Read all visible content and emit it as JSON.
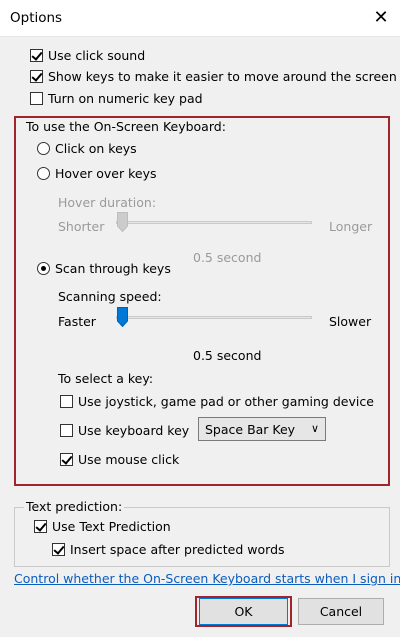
{
  "window": {
    "title": "Options",
    "close_glyph": "✕"
  },
  "top_options": [
    {
      "label": "Use click sound",
      "checked": true
    },
    {
      "label": "Show keys to make it easier to move around the screen",
      "checked": true
    },
    {
      "label": "Turn on numeric key pad",
      "checked": false
    }
  ],
  "osk": {
    "group_title": "To use the On-Screen Keyboard:",
    "click_on_keys": "Click on keys",
    "hover_over_keys": "Hover over keys",
    "hover_duration_label": "Hover duration:",
    "hover_shorter": "Shorter",
    "hover_longer": "Longer",
    "hover_value": "0.5 second",
    "scan_through_keys": "Scan through keys",
    "selected_mode": "scan",
    "scanning_speed_label": "Scanning speed:",
    "scan_faster": "Faster",
    "scan_slower": "Slower",
    "scan_value": "0.5 second",
    "select_key_label": "To select a key:",
    "joystick_label": "Use joystick, game pad or other gaming device",
    "joystick_checked": false,
    "keyboard_key_label": "Use keyboard key",
    "keyboard_key_checked": false,
    "keyboard_key_value": "Space Bar Key",
    "mouse_click_label": "Use mouse click",
    "mouse_click_checked": true
  },
  "text_prediction": {
    "group_title": "Text prediction:",
    "use_label": "Use Text Prediction",
    "use_checked": true,
    "insert_space_label": "Insert space after predicted words",
    "insert_space_checked": true
  },
  "link_text": "Control whether the On-Screen Keyboard starts when I sign in",
  "buttons": {
    "ok": "OK",
    "cancel": "Cancel"
  },
  "colors": {
    "highlight_border": "#a3252c",
    "link": "#0b5cbf",
    "slider_active": "#0078d7"
  }
}
